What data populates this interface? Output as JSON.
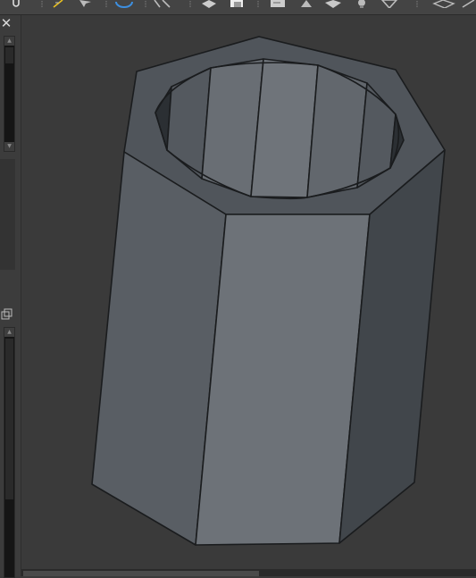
{
  "toolbar": {
    "icons": [
      "link-icon",
      "ruler-icon",
      "cursor-icon",
      "rotate-icon",
      "wrench-icon",
      "cube-icon",
      "copy-icon",
      "document-icon",
      "cone-icon",
      "cube-shaded-icon",
      "bulb-icon",
      "funnel-icon",
      "plane-icon",
      "cut-icon"
    ]
  },
  "side_panel": {
    "close_glyph": "✕"
  },
  "viewport": {
    "object": "octagonal-tube",
    "colors": {
      "background": "#3a3a3a",
      "face_front": "#6d7278",
      "face_left": "#595e64",
      "face_right": "#41464b",
      "face_top": "#50555b",
      "inner_dark": "#2b2f33",
      "inner_mid": "#54595f",
      "inner_light": "#6f747a",
      "edge": "#1a1c1e"
    }
  }
}
